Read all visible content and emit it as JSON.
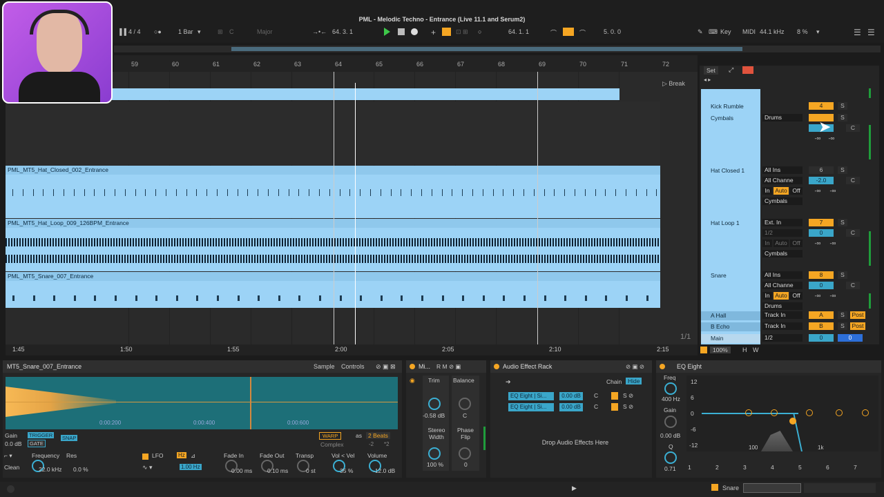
{
  "app_title": "PML - Melodic Techno - Entrance (Live 11.1 and Serum2)",
  "transport": {
    "time_sig": "4 / 4",
    "quantize": "1 Bar",
    "key_root": "C",
    "scale": "Major",
    "position": "64.  3.  1",
    "loop_start": "64.  1.  1",
    "loop_length": "5.  0.  0",
    "key_label": "Key",
    "midi_label": "MIDI",
    "sample_rate": "44.1 kHz",
    "cpu": "8 %"
  },
  "ruler": {
    "bars": [
      "59",
      "60",
      "61",
      "62",
      "63",
      "64",
      "65",
      "66",
      "67",
      "68",
      "69",
      "70",
      "71",
      "72"
    ],
    "locator": "Break",
    "times": [
      "1:45",
      "1:50",
      "1:55",
      "2:00",
      "2:05",
      "2:10",
      "2:15"
    ]
  },
  "clips": {
    "hat_closed": "PML_MT5_Hat_Closed_002_Entrance",
    "hat_loop": "PML_MT5_Hat_Loop_009_126BPM_Entrance",
    "snare": "PML_MT5_Snare_007_Entrance"
  },
  "mixer": {
    "set_label": "Set",
    "tracks": [
      {
        "name": "Kick Rumble",
        "number": "4",
        "solo": "S"
      },
      {
        "name": "Cymbals",
        "input": "Drums",
        "solo": "S",
        "pan": "C",
        "vol_a": "-∞",
        "vol_b": "-∞"
      },
      {
        "name": "Hat Closed 1",
        "input": "All Ins",
        "channel": "All Channe",
        "number": "6",
        "solo": "S",
        "vol": "-2.0",
        "pan": "C",
        "mon_in": "In",
        "mon_auto": "Auto",
        "mon_off": "Off",
        "vol_a": "-∞",
        "vol_b": "-∞",
        "output": "Cymbals"
      },
      {
        "name": "Hat Loop 1",
        "input": "Ext. In",
        "channel": "1/2",
        "number": "7",
        "solo": "S",
        "vol": "0",
        "pan": "C",
        "mon_in": "In",
        "mon_auto": "Auto",
        "mon_off": "Off",
        "vol_a": "-∞",
        "vol_b": "-∞",
        "output": "Cymbals"
      },
      {
        "name": "Snare",
        "input": "All Ins",
        "channel": "All Channe",
        "number": "8",
        "solo": "S",
        "vol": "0",
        "pan": "C",
        "mon_in": "In",
        "mon_auto": "Auto",
        "mon_off": "Off",
        "vol_a": "-∞",
        "vol_b": "-∞",
        "output": "Drums"
      }
    ],
    "returns": [
      {
        "name": "A Hall",
        "input": "Track In",
        "letter": "A",
        "solo": "S",
        "post": "Post"
      },
      {
        "name": "B Echo",
        "input": "Track In",
        "letter": "B",
        "solo": "S",
        "post": "Post"
      }
    ],
    "main": {
      "name": "Main",
      "input": "1/2",
      "vol": "0",
      "pan": "0"
    },
    "page": "1/1",
    "zoom": "100%",
    "h_label": "H",
    "w_label": "W"
  },
  "sample_panel": {
    "title": "MT5_Snare_007_Entrance",
    "tabs": [
      "Sample",
      "Controls"
    ],
    "time_marks": [
      "0:00:200",
      "0:00:400",
      "0:00:600"
    ],
    "gain_label": "Gain",
    "gain_value": "0.0 dB",
    "trigger": "TRIGGER",
    "gate": "GATE",
    "snap": "SNAP",
    "warp": "WARP",
    "as": "as",
    "beats": "2 Beats",
    "complex": "Complex",
    "minus": "-2",
    "plus": "*2",
    "filter_label": "Frequency",
    "res_label": "Res",
    "filter_type": "Clean",
    "freq_value": "22.0 kHz",
    "res_value": "0.0 %",
    "lfo_label": "LFO",
    "hz_label": "Hz",
    "lfo_rate": "1.00 Hz",
    "fade_in_label": "Fade In",
    "fade_in_value": "0.00 ms",
    "fade_out_label": "Fade Out",
    "fade_out_value": "0.10 ms",
    "transp_label": "Transp",
    "transp_value": "0 st",
    "vol_vel_label": "Vol < Vel",
    "vol_vel_value": "35 %",
    "volume_label": "Volume",
    "volume_value": "-12.0 dB"
  },
  "utility_panel": {
    "title": "Mi...",
    "trim_label": "Trim",
    "trim_value": "-0.58 dB",
    "balance_label": "Balance",
    "balance_value": "C",
    "width_label": "Stereo Width",
    "width_value": "100 %",
    "phase_label": "Phase Flip",
    "phase_value": "0"
  },
  "rack_panel": {
    "title": "Audio Effect Rack",
    "chain": "Chain",
    "hide": "Hide",
    "chains": [
      {
        "name": "EQ Eight | Si...",
        "vol": "0.00 dB",
        "pan": "C"
      },
      {
        "name": "EQ Eight | Si...",
        "vol": "0.00 dB",
        "pan": "C"
      }
    ],
    "drop_text": "Drop Audio Effects Here"
  },
  "eq_panel": {
    "title": "EQ Eight",
    "freq_label": "Freq",
    "freq_value": "400 Hz",
    "gain_label": "Gain",
    "gain_value": "0.00 dB",
    "q_label": "Q",
    "q_value": "0.71",
    "db_labels": [
      "12",
      "6",
      "0",
      "-6",
      "-12"
    ],
    "freq_labels": [
      "100",
      "1k"
    ],
    "bands": [
      "1",
      "2",
      "3",
      "4",
      "5",
      "6",
      "7"
    ]
  },
  "status": {
    "track": "Snare"
  },
  "colors": {
    "clip": "#9cd3f6",
    "accent": "#f5a623",
    "track_blue": "#3aa6c9"
  }
}
